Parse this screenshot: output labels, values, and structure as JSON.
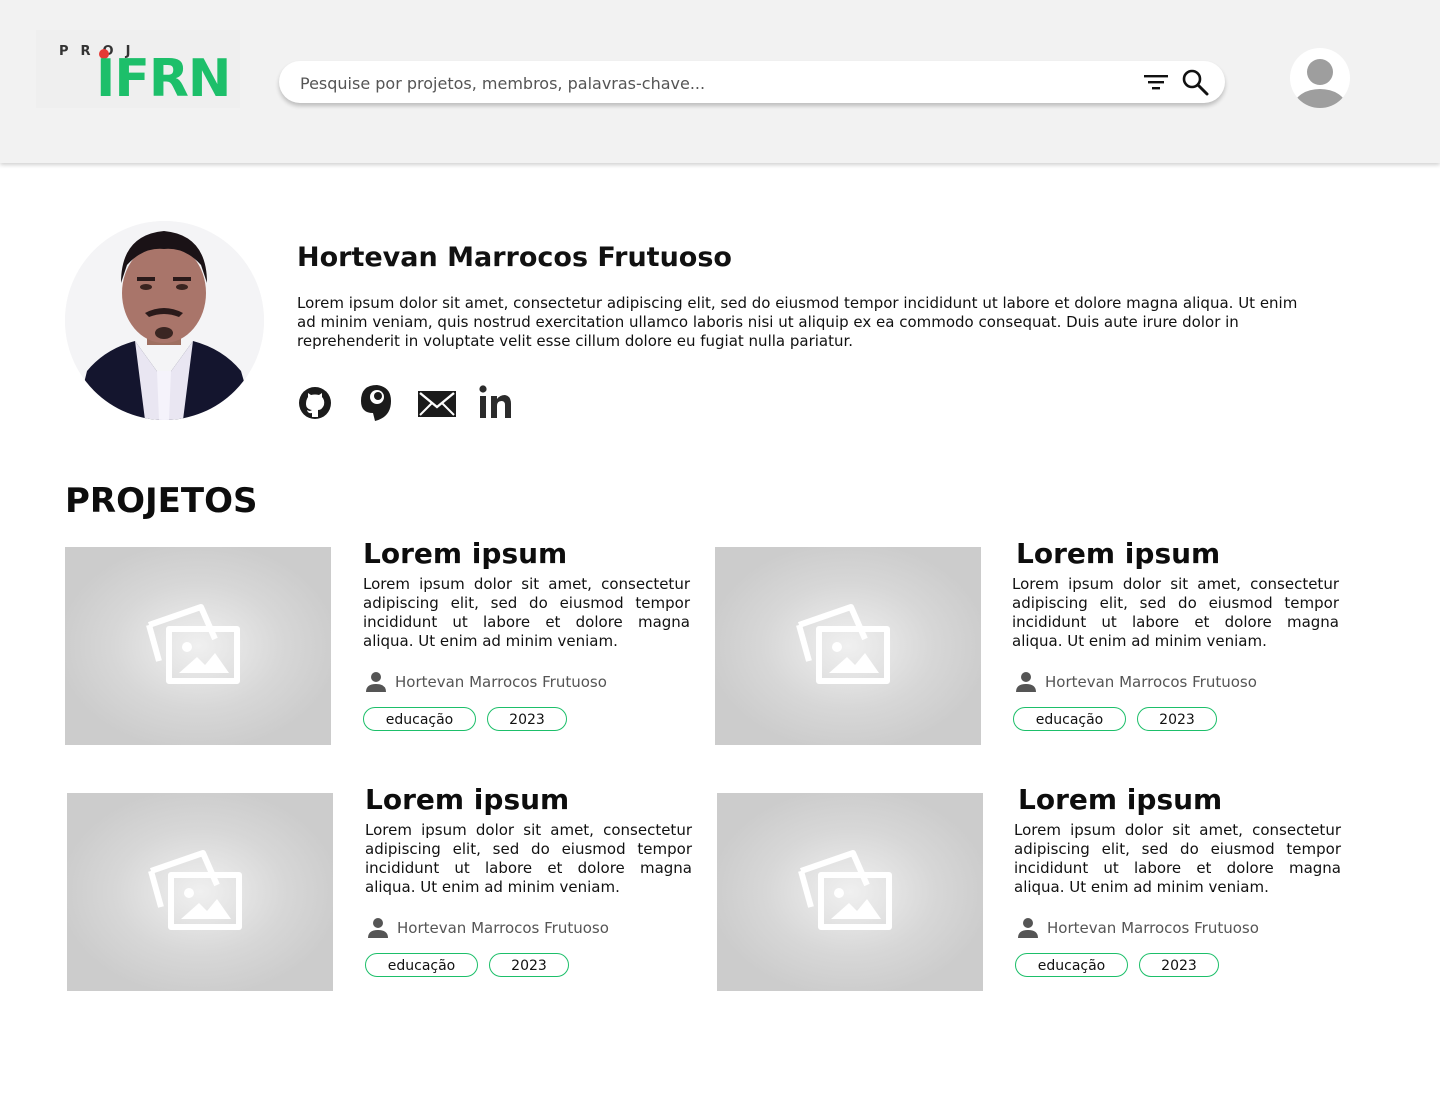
{
  "header": {
    "logo_top": "PROJ",
    "logo_main": "IFRN",
    "search_placeholder": "Pesquise por projetos, membros, palavras-chave..."
  },
  "profile": {
    "name": "Hortevan Marrocos Frutuoso",
    "bio": "Lorem ipsum dolor sit amet, consectetur adipiscing elit, sed do eiusmod tempor incididunt ut labore et dolore magna aliqua. Ut enim ad minim veniam, quis nostrud exercitation ullamco laboris nisi ut aliquip ex ea commodo consequat. Duis aute irure dolor in reprehenderit in voluptate velit esse cillum dolore eu fugiat nulla pariatur.",
    "socials": [
      "github-icon",
      "lattes-icon",
      "email-icon",
      "linkedin-icon"
    ]
  },
  "projects": {
    "title": "PROJETOS",
    "items": [
      {
        "title": "Lorem ipsum",
        "description": "Lorem ipsum dolor sit amet, consectetur adipiscing elit, sed do eiusmod tempor incididunt ut labore et dolore magna aliqua. Ut enim ad minim veniam.",
        "author": "Hortevan Marrocos Frutuoso",
        "tags": [
          "educação",
          "2023"
        ]
      },
      {
        "title": "Lorem ipsum",
        "description": "Lorem ipsum dolor sit amet, consectetur adipiscing elit, sed do eiusmod tempor incididunt ut labore et dolore magna aliqua. Ut enim ad minim veniam.",
        "author": "Hortevan Marrocos Frutuoso",
        "tags": [
          "educação",
          "2023"
        ]
      },
      {
        "title": "Lorem ipsum",
        "description": "Lorem ipsum dolor sit amet, consectetur adipiscing elit, sed do eiusmod tempor incididunt ut labore et dolore magna aliqua. Ut enim ad minim veniam.",
        "author": "Hortevan Marrocos Frutuoso",
        "tags": [
          "educação",
          "2023"
        ]
      },
      {
        "title": "Lorem ipsum",
        "description": "Lorem ipsum dolor sit amet, consectetur adipiscing elit, sed do eiusmod tempor incididunt ut labore et dolore magna aliqua. Ut enim ad minim veniam.",
        "author": "Hortevan Marrocos Frutuoso",
        "tags": [
          "educação",
          "2023"
        ]
      }
    ]
  },
  "colors": {
    "brand_green": "#1dbf6a",
    "brand_red": "#e53935",
    "header_bg": "#f2f2f2"
  }
}
